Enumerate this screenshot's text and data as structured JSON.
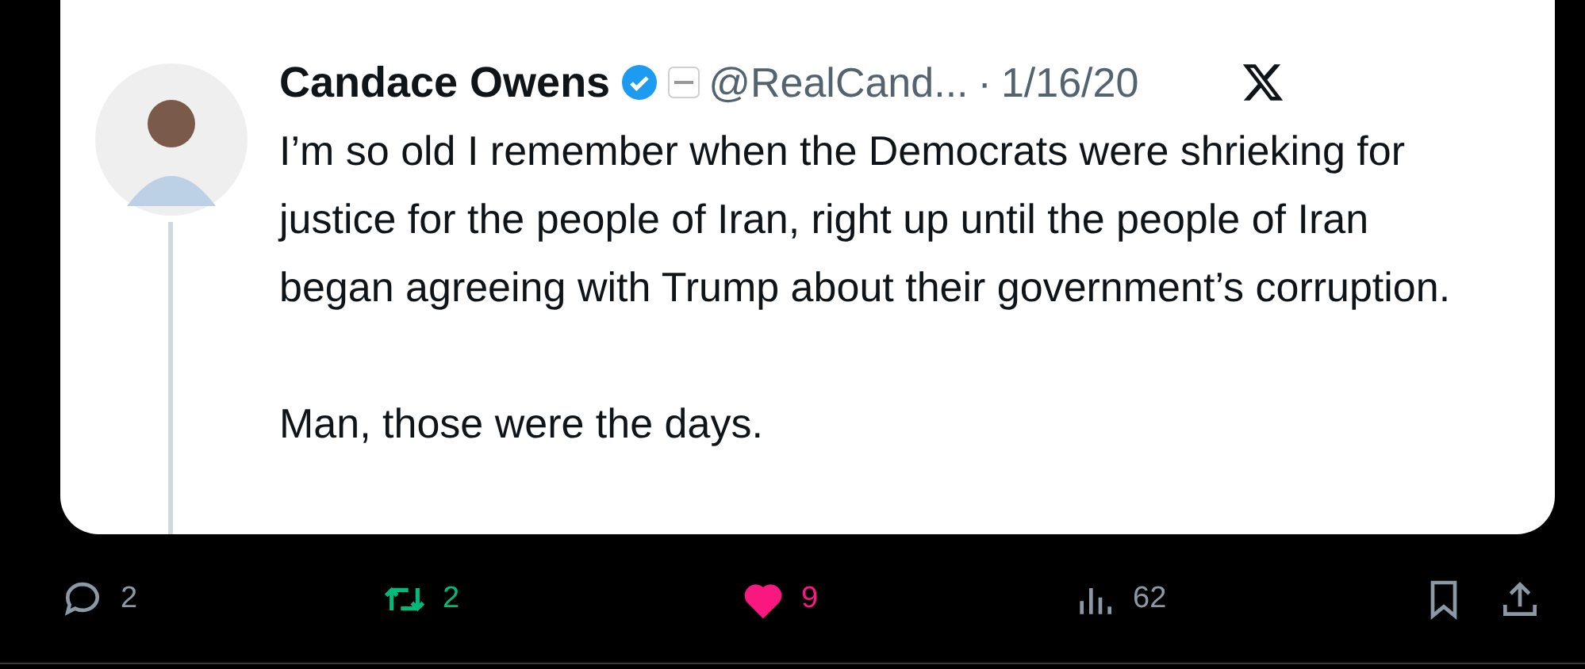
{
  "tweet": {
    "author": "Candace Owens",
    "verified": true,
    "handle": "@RealCand...",
    "separator": "·",
    "date": "1/16/20",
    "paragraphs": [
      "I’m so old I remember when the Democrats were shrieking for justice for the people of Iran, right up until the people of Iran began agreeing with Trump about their government’s corruption.",
      "Man, those were the days."
    ]
  },
  "actions": [
    {
      "kind": "reply",
      "count": "2",
      "active": false
    },
    {
      "kind": "repost",
      "count": "2",
      "active": true
    },
    {
      "kind": "like",
      "count": "9",
      "active": true
    },
    {
      "kind": "views",
      "count": "62",
      "active": false
    },
    {
      "kind": "bookmark",
      "active": false
    },
    {
      "kind": "share"
    }
  ]
}
